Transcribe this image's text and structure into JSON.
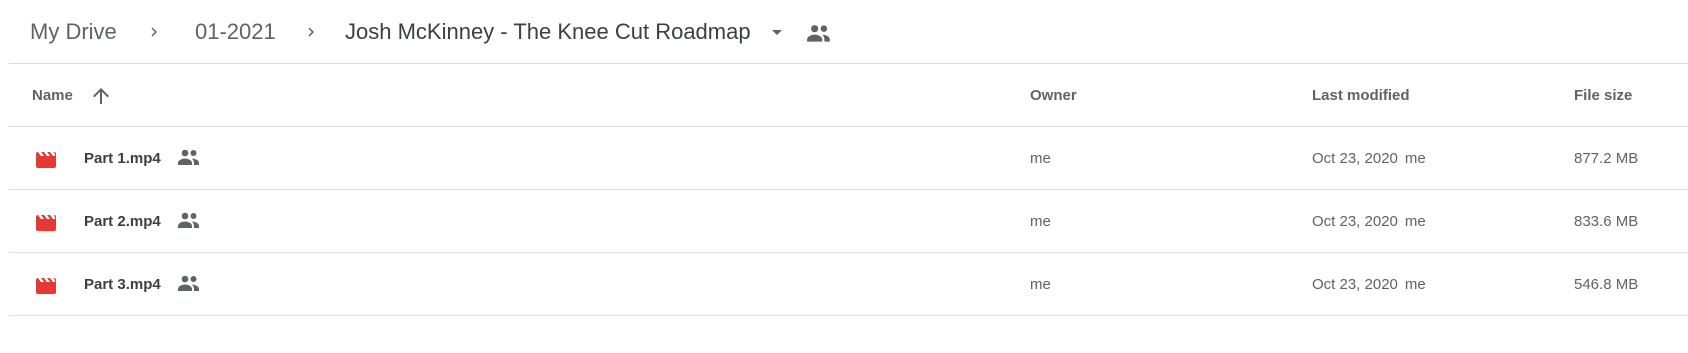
{
  "breadcrumb": {
    "items": [
      "My Drive",
      "01-2021"
    ],
    "current": "Josh McKinney - The Knee Cut Roadmap"
  },
  "columns": {
    "name": "Name",
    "owner": "Owner",
    "last_modified": "Last modified",
    "file_size": "File size"
  },
  "files": [
    {
      "name": "Part 1.mp4",
      "owner": "me",
      "modified_date": "Oct 23, 2020",
      "modified_by": "me",
      "size": "877.2 MB"
    },
    {
      "name": "Part 2.mp4",
      "owner": "me",
      "modified_date": "Oct 23, 2020",
      "modified_by": "me",
      "size": "833.6 MB"
    },
    {
      "name": "Part 3.mp4",
      "owner": "me",
      "modified_date": "Oct 23, 2020",
      "modified_by": "me",
      "size": "546.8 MB"
    }
  ],
  "icons": {
    "separator": "chevron-right-icon",
    "folder_menu": "caret-down-icon",
    "shared": "people-icon",
    "sort": "arrow-up-icon",
    "file": "video-file-icon"
  },
  "colors": {
    "video_icon": "#e53935",
    "muted_text": "#5f6368",
    "divider": "#dadce0"
  },
  "sort": {
    "column": "name",
    "direction": "ascending"
  }
}
